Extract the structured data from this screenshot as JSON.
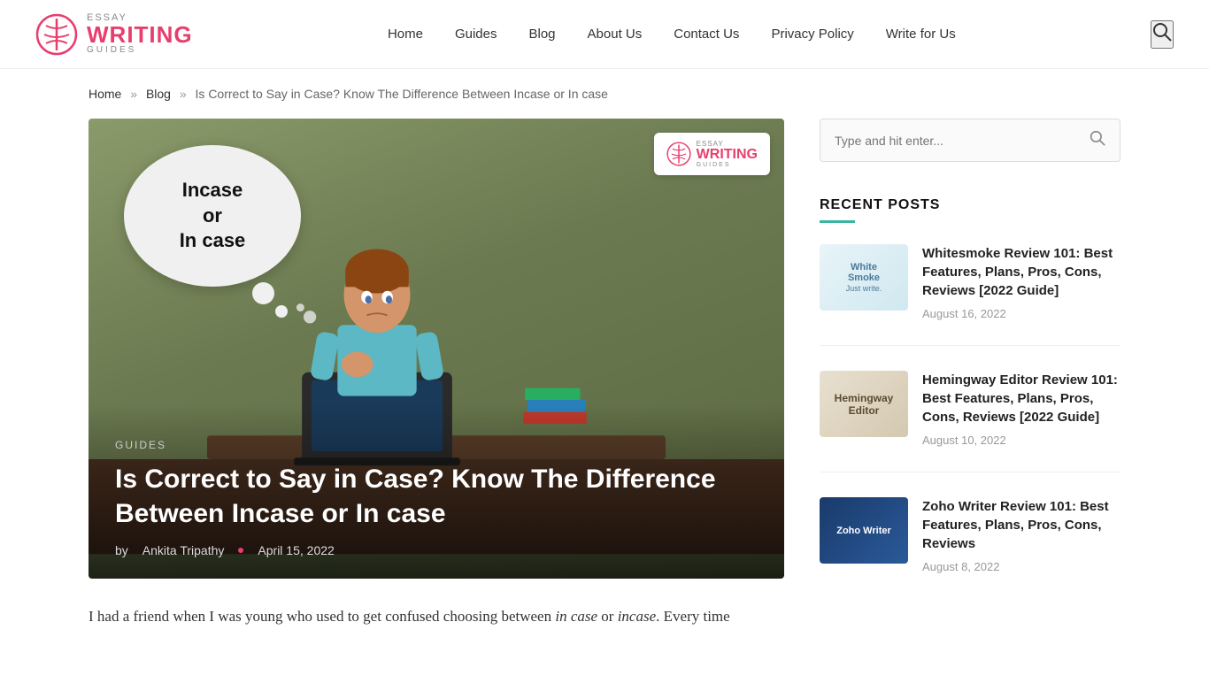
{
  "header": {
    "logo": {
      "essay": "ESSAY",
      "writing": "WRITING",
      "guides": "GUIDES"
    },
    "nav": {
      "home": "Home",
      "guides": "Guides",
      "blog": "Blog",
      "about": "About Us",
      "contact": "Contact Us",
      "privacy": "Privacy Policy",
      "write": "Write for Us"
    }
  },
  "breadcrumb": {
    "home": "Home",
    "blog": "Blog",
    "current": "Is Correct to Say in Case? Know The Difference Between Incase or In case"
  },
  "article": {
    "category": "GUIDES",
    "title": "Is Correct to Say in Case? Know The Difference Between Incase or In case",
    "author": "Ankita Tripathy",
    "date": "April 15, 2022",
    "thought_bubble": "Incase\nor\nIn case",
    "intro": "I had a friend when I was young who used to get confused choosing between in case or incase. Every time"
  },
  "sidebar": {
    "search_placeholder": "Type and hit enter...",
    "recent_posts_label": "RECENT POSTS",
    "posts": [
      {
        "thumb_type": "whitesmoke",
        "thumb_text": "WhiteSmoke",
        "title": "Whitesmoke Review 101: Best Features, Plans, Pros, Cons, Reviews [2022 Guide]",
        "date": "August 16, 2022"
      },
      {
        "thumb_type": "hemingway",
        "thumb_text": "Hemingway\nEditor",
        "title": "Hemingway Editor Review 101: Best Features, Plans, Pros, Cons, Reviews [2022 Guide]",
        "date": "August 10, 2022"
      },
      {
        "thumb_type": "zoho",
        "thumb_text": "Zoho Writer",
        "title": "Zoho Writer Review 101: Best Features, Plans, Pros, Cons, Reviews",
        "date": "August 8, 2022"
      }
    ]
  }
}
